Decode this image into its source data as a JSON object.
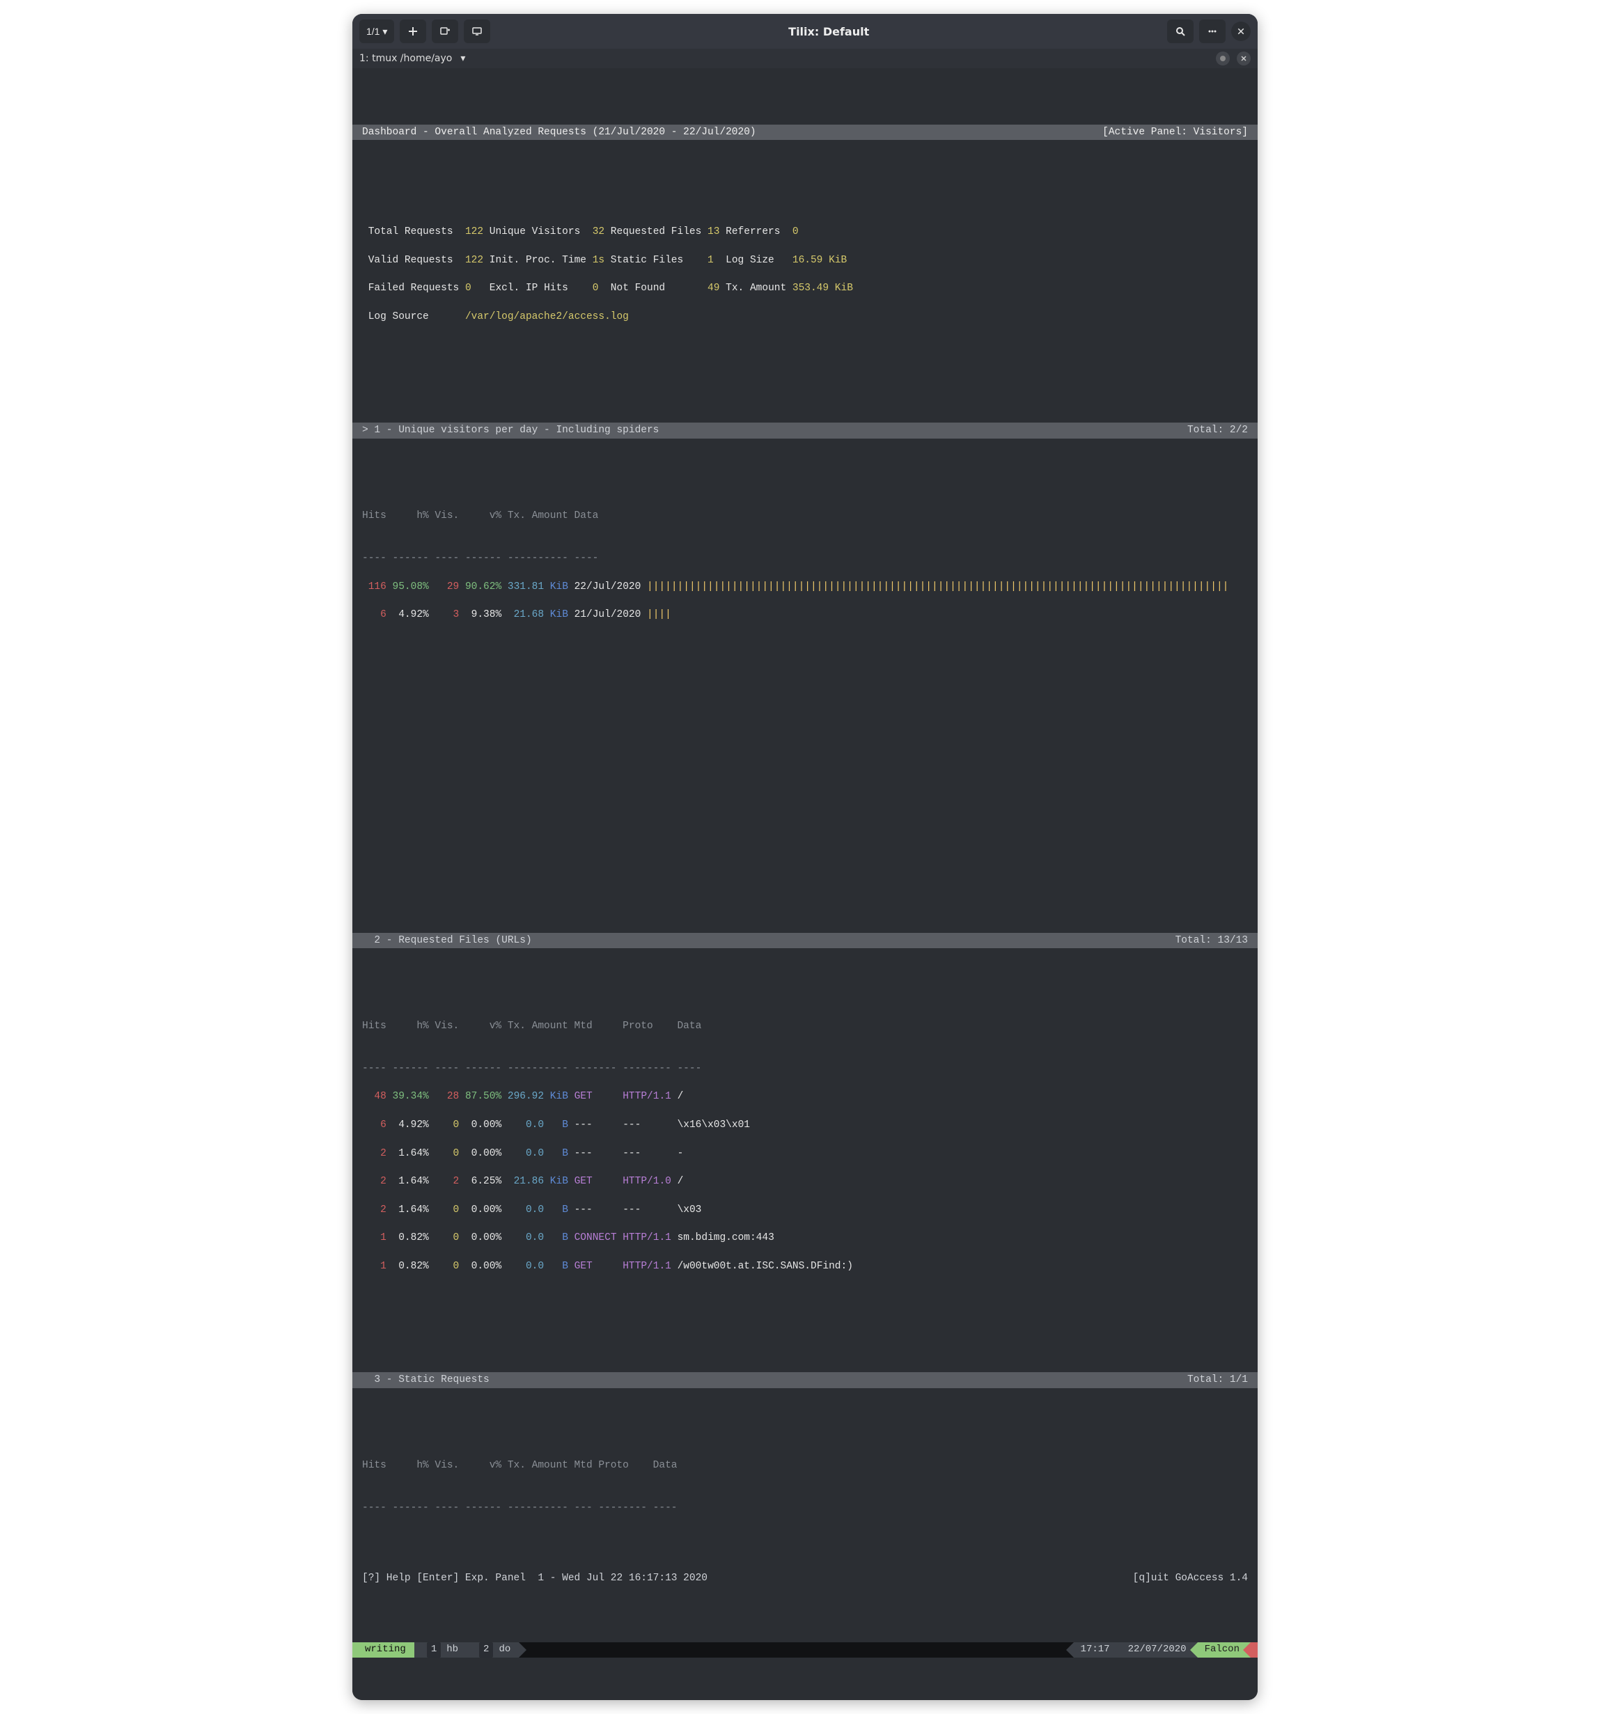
{
  "titlebar": {
    "session_label": "1/1 ▾",
    "title": "Tilix: Default"
  },
  "tabbar": {
    "tab_label": "1: tmux  /home/ayo",
    "chevron": "▾"
  },
  "dashboard": {
    "header_left": "Dashboard - Overall Analyzed Requests (21/Jul/2020 - 22/Jul/2020)",
    "header_right": "[Active Panel: Visitors]",
    "stats": {
      "total_requests_label": "Total Requests",
      "total_requests": "122",
      "unique_visitors_label": "Unique Visitors",
      "unique_visitors": "32",
      "requested_files_label": "Requested Files",
      "requested_files": "13",
      "referrers_label": "Referrers",
      "referrers": "0",
      "valid_requests_label": "Valid Requests",
      "valid_requests": "122",
      "init_proc_label": "Init. Proc. Time",
      "init_proc": "1s",
      "static_files_label": "Static Files",
      "static_files": "1",
      "log_size_label": "Log Size",
      "log_size": "16.59 KiB",
      "failed_requests_label": "Failed Requests",
      "failed_requests": "0",
      "excl_ip_label": "Excl. IP Hits",
      "excl_ip": "0",
      "not_found_label": "Not Found",
      "not_found": "49",
      "tx_amount_label": "Tx. Amount",
      "tx_amount": "353.49 KiB",
      "log_source_label": "Log Source",
      "log_source": "/var/log/apache2/access.log"
    }
  },
  "panel1": {
    "title": "> 1 - Unique visitors per day - Including spiders",
    "total": "Total: 2/2",
    "columns": "Hits     h% Vis.     v% Tx. Amount Data",
    "rules": "---- ------ ---- ------ ---------- ----",
    "rows": [
      {
        "hits": "116",
        "hp": "95.08%",
        "vis": "29",
        "vp": "90.62%",
        "tx": "331.81",
        "unit": "KiB",
        "data": "22/Jul/2020",
        "bar": "||||||||||||||||||||||||||||||||||||||||||||||||||||||||||||||||||||||||||||||||||||||||||||||||"
      },
      {
        "hits": "6",
        "hp": "4.92%",
        "vis": "3",
        "vp": "9.38%",
        "tx": "21.68",
        "unit": "KiB",
        "data": "21/Jul/2020",
        "bar": "||||"
      }
    ]
  },
  "panel2": {
    "title": "  2 - Requested Files (URLs)",
    "total": "Total: 13/13",
    "columns": "Hits     h% Vis.     v% Tx. Amount Mtd     Proto    Data",
    "rules": "---- ------ ---- ------ ---------- ------- -------- ----",
    "rows": [
      {
        "hits": "48",
        "hp": "39.34%",
        "vis": "28",
        "vp": "87.50%",
        "tx": "296.92",
        "unit": "KiB",
        "mtd": "GET",
        "proto": "HTTP/1.1",
        "data": "/"
      },
      {
        "hits": "6",
        "hp": "4.92%",
        "vis": "0",
        "vp": "0.00%",
        "tx": "0.0",
        "unit": "B",
        "mtd": "---",
        "proto": "---",
        "data": "\\x16\\x03\\x01"
      },
      {
        "hits": "2",
        "hp": "1.64%",
        "vis": "0",
        "vp": "0.00%",
        "tx": "0.0",
        "unit": "B",
        "mtd": "---",
        "proto": "---",
        "data": "-"
      },
      {
        "hits": "2",
        "hp": "1.64%",
        "vis": "2",
        "vp": "6.25%",
        "tx": "21.86",
        "unit": "KiB",
        "mtd": "GET",
        "proto": "HTTP/1.0",
        "data": "/"
      },
      {
        "hits": "2",
        "hp": "1.64%",
        "vis": "0",
        "vp": "0.00%",
        "tx": "0.0",
        "unit": "B",
        "mtd": "---",
        "proto": "---",
        "data": "\\x03"
      },
      {
        "hits": "1",
        "hp": "0.82%",
        "vis": "0",
        "vp": "0.00%",
        "tx": "0.0",
        "unit": "B",
        "mtd": "CONNECT",
        "proto": "HTTP/1.1",
        "data": "sm.bdimg.com:443"
      },
      {
        "hits": "1",
        "hp": "0.82%",
        "vis": "0",
        "vp": "0.00%",
        "tx": "0.0",
        "unit": "B",
        "mtd": "GET",
        "proto": "HTTP/1.1",
        "data": "/w00tw00t.at.ISC.SANS.DFind:)"
      }
    ]
  },
  "panel3": {
    "title": "  3 - Static Requests",
    "total": "Total: 1/1",
    "columns": "Hits     h% Vis.     v% Tx. Amount Mtd Proto    Data",
    "rules": "---- ------ ---- ------ ---------- --- -------- ----"
  },
  "footer": {
    "help": "[?] Help [Enter] Exp. Panel  1 - Wed Jul 22 16:17:13 2020",
    "quit": "[q]uit GoAccess 1.4"
  },
  "statusbar": {
    "mode": "writing",
    "win1_num": "1",
    "win1": "hb",
    "win2_num": "2",
    "win2": "do",
    "time": "17:17",
    "date": "22/07/2020",
    "host": "Falcon"
  }
}
